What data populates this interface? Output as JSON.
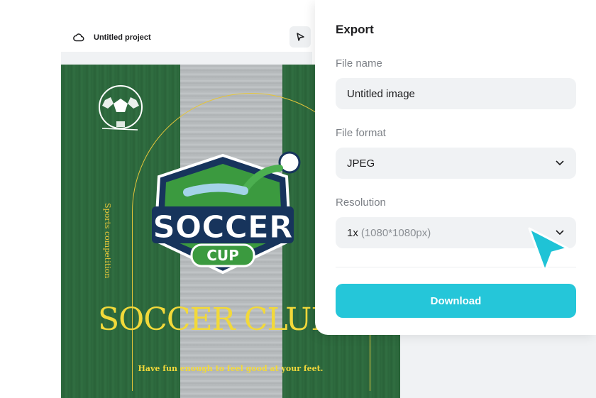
{
  "editor": {
    "project_title": "Untitled project",
    "project_icon": "cloud-icon",
    "pointer_icon": "pointer-icon"
  },
  "design": {
    "vertical_text": "Sports competition",
    "badge_word": "SOCCER",
    "badge_sub": "CUP",
    "club_title": "SOCCER CLUB",
    "tagline": "Have fun enough to feel good at your feet."
  },
  "export": {
    "title": "Export",
    "file_name_label": "File name",
    "file_name_value": "Untitled image",
    "file_format_label": "File format",
    "file_format_value": "JPEG",
    "resolution_label": "Resolution",
    "resolution_value": "1x",
    "resolution_detail": "(1080*1080px)",
    "download_label": "Download"
  },
  "colors": {
    "accent": "#25c6d9",
    "cursor": "#1fc3d6",
    "gold": "#f2d93a",
    "field_bg": "#f0f2f4"
  }
}
